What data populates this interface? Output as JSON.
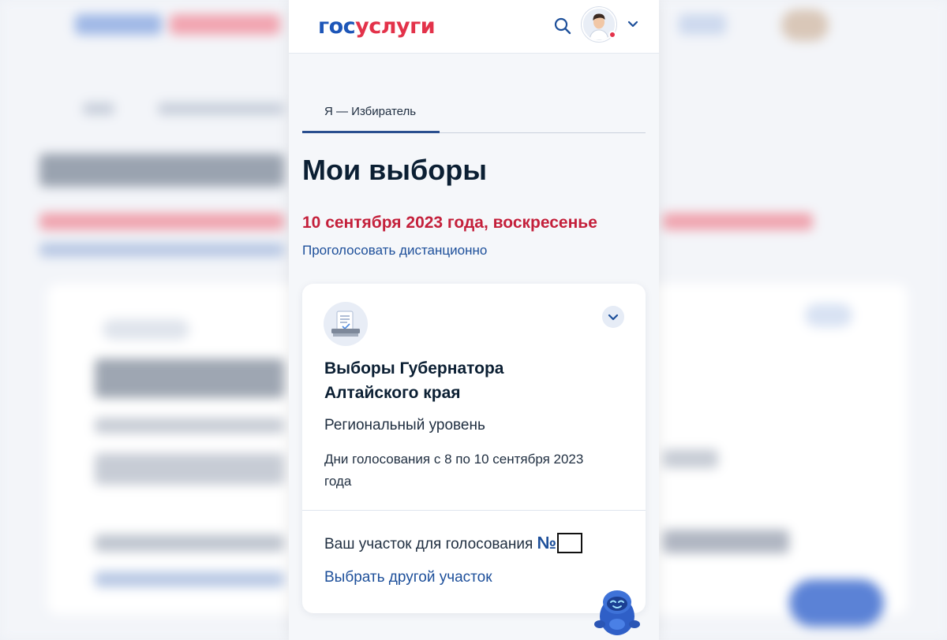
{
  "header": {
    "logo_part1": "гос",
    "logo_part2": "услуги",
    "search_icon": "search-icon",
    "avatar_icon": "user-avatar",
    "menu_chevron": "chevron-down-icon"
  },
  "tabs": [
    {
      "label": "Я — Избиратель",
      "active": true
    }
  ],
  "main": {
    "title": "Мои выборы",
    "date": "10 сентября 2023 года, воскресенье",
    "vote_remote_link": "Проголосовать дистанционно"
  },
  "card": {
    "title": "Выборы Губернатора Алтайского края",
    "level": "Региональный уровень",
    "voting_days": "Дни голосования с 8 по 10 сентября 2023 года",
    "station_label": "Ваш участок для голосования",
    "station_number_sign": "№",
    "change_station_link": "Выбрать другой участок"
  },
  "colors": {
    "brand_blue": "#1d56b8",
    "brand_red": "#e3324a",
    "date_red": "#c4203b",
    "link_blue": "#1d4f9a"
  }
}
